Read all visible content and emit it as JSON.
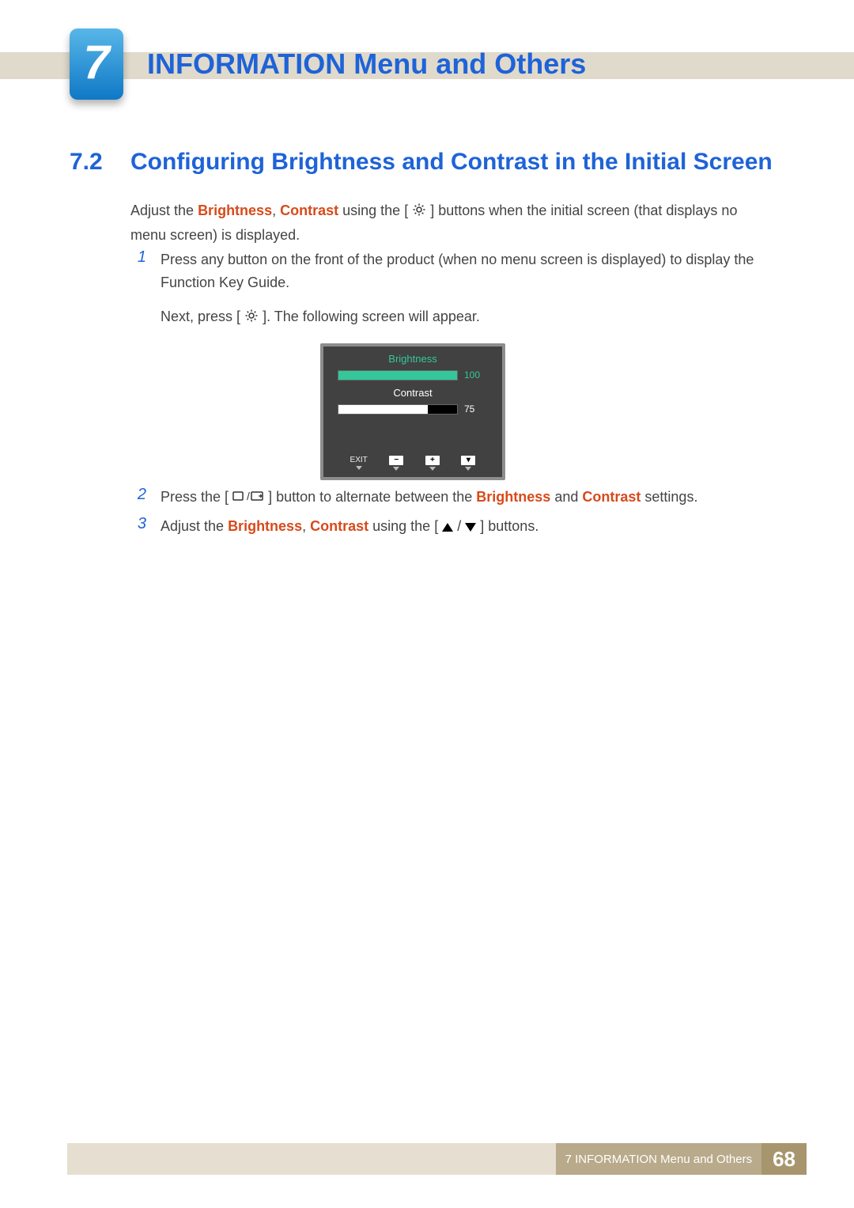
{
  "chapter": {
    "number": "7",
    "title": "INFORMATION Menu and Others"
  },
  "section": {
    "number": "7.2",
    "title": "Configuring Brightness and Contrast in the Initial Screen"
  },
  "intro": {
    "pre": "Adjust the ",
    "kw1": "Brightness",
    "sep1": ", ",
    "kw2": "Contrast",
    "mid": " using the [",
    "post": "] buttons when the initial screen (that displays no menu screen) is displayed."
  },
  "steps": {
    "s1": {
      "num": "1",
      "line1": "Press any button on the front of the product (when no menu screen is displayed) to display the Function Key Guide.",
      "line2a": "Next, press [",
      "line2b": "]. The following screen will appear."
    },
    "s2": {
      "num": "2",
      "a": "Press the [",
      "b": "] button to alternate between the ",
      "kw1": "Brightness",
      "and": " and ",
      "kw2": "Contrast",
      "c": " settings."
    },
    "s3": {
      "num": "3",
      "a": "Adjust the ",
      "kw1": "Brightness",
      "sep": ", ",
      "kw2": "Contrast",
      "b": " using the [",
      "c": "] buttons."
    }
  },
  "osd": {
    "brightness": {
      "label": "Brightness",
      "value": "100",
      "percent": 100
    },
    "contrast": {
      "label": "Contrast",
      "value": "75",
      "percent": 75
    },
    "exit": "EXIT",
    "minus": "−",
    "plus": "+",
    "down": "▾"
  },
  "footer": {
    "label": "7 INFORMATION Menu and Others",
    "page": "68"
  }
}
